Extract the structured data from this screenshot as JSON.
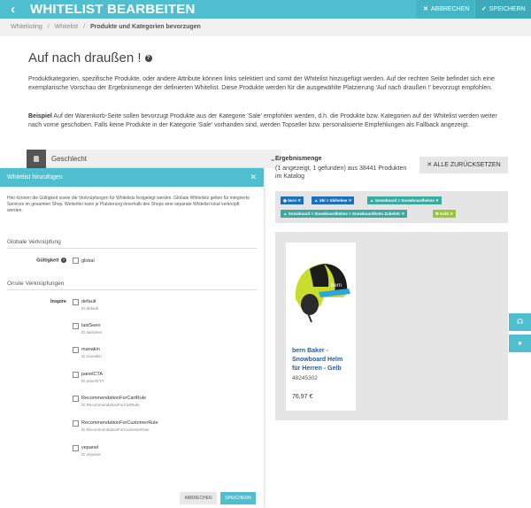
{
  "header": {
    "back_icon": "‹",
    "title": "WHITELIST BEARBEITEN",
    "cancel_label": "ABBRECHEN",
    "save_label": "SPEICHERN",
    "accent": "#4fbfcf"
  },
  "breadcrumb": [
    "Whitelisting",
    "Whitelist",
    "Produkte und Kategorien bevorzugen"
  ],
  "page": {
    "title": "Auf nach draußen !",
    "description": "Produktkategorien, spezifische Produkte, oder andere Attribute können links selektiert und somit der Whitelist hinzugefügt werden. Auf der rechten Seite befindet sich eine exemplarische Vorschau der Ergebnismenge der definierten Whitelist. Diese Produkte werden für die ausgewählte Platzierung 'Auf nach draußen !' bevorzugt empfohlen.",
    "example_bold": "Beispiel",
    "example_text": " Auf der Warenkorb-Seite sollen bevorzugt Produkte aus der Kategorie 'Sale' empfohlen werden, d.h. die Produkte bzw. Kategorien auf der Whitelist werden weiter nach vorne geschoben. Falls keine Produkte in der Kategorie 'Sale' vorhanden sind, werden Topseller bzw. personalisierte Empfehlungen als Fallback angezeigt."
  },
  "accordion": {
    "label": "Geschlecht"
  },
  "modal": {
    "title": "Whitelist hinzufügen",
    "description": "Hier können die Gültigkeit sowie die Verknüpfungen für Whitelists festgelegt werden. Globale Whitelists gelten für integrierte Services im gesamten Shop. Weiterhin kann je Platzierung innerhalb des Shops eine separate Whitelist lokal verknüpft werden.",
    "global_section": "Globale Verknüpfung",
    "validity_label": "Gültigkeit",
    "global_option": "global",
    "onsite_section": "Onsite Verknüpfungen",
    "inspire_label": "Inspire",
    "options": [
      {
        "label": "default",
        "id": "ID default"
      },
      {
        "label": "lastSeen",
        "id": "ID lastSeen"
      },
      {
        "label": "manakin",
        "id": "ID manakin"
      },
      {
        "label": "panelCTA",
        "id": "ID panelCTA"
      },
      {
        "label": "RecommendationForCartRule",
        "id": "ID RecommendationForCartRule"
      },
      {
        "label": "RecommendationForCustomerRule",
        "id": "ID RecommendationForCustomerRule"
      },
      {
        "label": "vepanel",
        "id": "ID vepanel"
      }
    ],
    "cancel_label": "ABBRECHEN",
    "save_label": "SPEICHERN"
  },
  "results": {
    "title": "Ergebnismenge",
    "subtitle": "(1 angezeigt, 1 gefunden) aus 38441 Produkten im Katalog",
    "reset_label": "ALLE ZURÜCKSETZEN",
    "tags": [
      {
        "label": "bern",
        "color": "#1d6fb8"
      },
      {
        "label": "Ski > Skihelme",
        "color": "#1d6fb8"
      },
      {
        "label": "Snowboard > Snowboardhelme",
        "color": "#3aa9a0"
      },
      {
        "label": "Snowboard > Snowboardhelme > Snowboardhelm Zubehör",
        "color": "#3aa9a0"
      },
      {
        "label": "Gelb",
        "color": "#9cc43b"
      }
    ],
    "product": {
      "name": "bern Baker - Snowboard Helm für Herren - Gelb",
      "id": "48245302",
      "price": "76,97 €"
    }
  },
  "side_buttons": [
    "headset-icon",
    "chat-icon"
  ]
}
